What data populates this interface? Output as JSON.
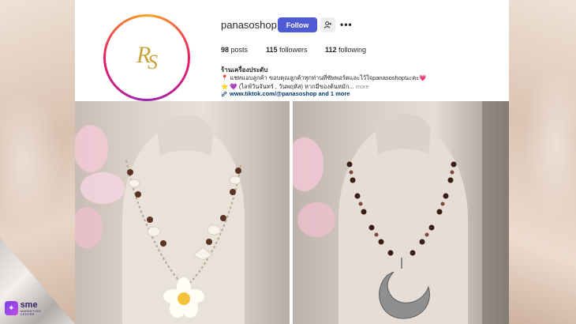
{
  "profile": {
    "username": "panasoshop",
    "avatar_monogram": "RS",
    "follow_label": "Follow",
    "add_user_icon": "add-user-icon",
    "more_icon": "more-horizontal-icon",
    "more_glyph": "•••"
  },
  "stats": {
    "posts_count": "98",
    "posts_label": "posts",
    "followers_count": "115",
    "followers_label": "followers",
    "following_count": "112",
    "following_label": "following"
  },
  "bio": {
    "name": "ร้านเครื่องประดับ",
    "pin_icon": "📍",
    "text": "แชทแอบลูกค้า ขอบคุณลูกค้าทุกท่านที่ซัพพอร์ตและไว้ใจpanasoshopนะคะ💗 ⭐ 💜 (ไลฟ์วันจันทร์ , วันพฤหัส) หากมีของต้นหมัก...",
    "more_label": "more"
  },
  "link": {
    "icon": "link-icon",
    "text": "www.tiktok.com/@panasoshop and 1 more"
  },
  "posts": [
    {
      "name": "shell-flower-necklace",
      "description_icon": "necklace-photo"
    },
    {
      "name": "moon-pendant-necklace",
      "description_icon": "necklace-photo"
    }
  ],
  "brand": {
    "logo_text": "sme",
    "logo_subtext": "MARKETING CENTER"
  },
  "colors": {
    "follow_button": "#4f5bd5",
    "link_text": "#00376b",
    "monogram": "#c9a43a"
  }
}
